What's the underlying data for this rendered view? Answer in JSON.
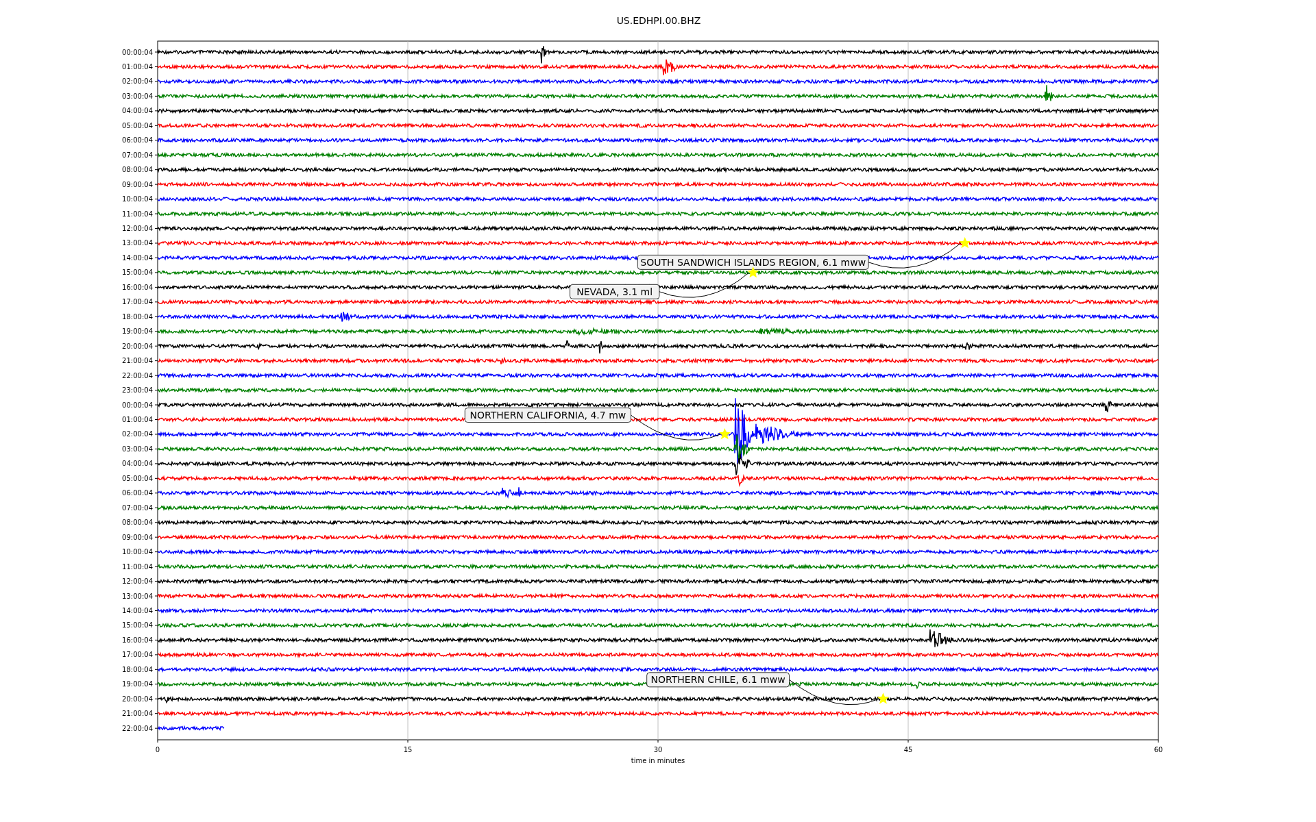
{
  "plot": {
    "title": "US.EDHPI.00.BHZ",
    "x_label": "time in minutes",
    "x_ticks": [
      "0",
      "15",
      "30",
      "45",
      "60"
    ],
    "rows": [
      {
        "label": "00:00:04",
        "color": "#000000"
      },
      {
        "label": "01:00:04",
        "color": "#ff0000"
      },
      {
        "label": "02:00:04",
        "color": "#0000ff"
      },
      {
        "label": "03:00:04",
        "color": "#008000"
      },
      {
        "label": "04:00:04",
        "color": "#000000"
      },
      {
        "label": "05:00:04",
        "color": "#ff0000"
      },
      {
        "label": "06:00:04",
        "color": "#0000ff"
      },
      {
        "label": "07:00:04",
        "color": "#008000"
      },
      {
        "label": "08:00:04",
        "color": "#000000"
      },
      {
        "label": "09:00:04",
        "color": "#ff0000"
      },
      {
        "label": "10:00:04",
        "color": "#0000ff"
      },
      {
        "label": "11:00:04",
        "color": "#008000"
      },
      {
        "label": "12:00:04",
        "color": "#000000"
      },
      {
        "label": "13:00:04",
        "color": "#ff0000"
      },
      {
        "label": "14:00:04",
        "color": "#0000ff"
      },
      {
        "label": "15:00:04",
        "color": "#008000"
      },
      {
        "label": "16:00:04",
        "color": "#000000"
      },
      {
        "label": "17:00:04",
        "color": "#ff0000"
      },
      {
        "label": "18:00:04",
        "color": "#0000ff"
      },
      {
        "label": "19:00:04",
        "color": "#008000"
      },
      {
        "label": "20:00:04",
        "color": "#000000"
      },
      {
        "label": "21:00:04",
        "color": "#ff0000"
      },
      {
        "label": "22:00:04",
        "color": "#0000ff"
      },
      {
        "label": "23:00:04",
        "color": "#008000"
      },
      {
        "label": "00:00:04",
        "color": "#000000"
      },
      {
        "label": "01:00:04",
        "color": "#ff0000"
      },
      {
        "label": "02:00:04",
        "color": "#0000ff"
      },
      {
        "label": "03:00:04",
        "color": "#008000"
      },
      {
        "label": "04:00:04",
        "color": "#000000"
      },
      {
        "label": "05:00:04",
        "color": "#ff0000"
      },
      {
        "label": "06:00:04",
        "color": "#0000ff"
      },
      {
        "label": "07:00:04",
        "color": "#008000"
      },
      {
        "label": "08:00:04",
        "color": "#000000"
      },
      {
        "label": "09:00:04",
        "color": "#ff0000"
      },
      {
        "label": "10:00:04",
        "color": "#0000ff"
      },
      {
        "label": "11:00:04",
        "color": "#008000"
      },
      {
        "label": "12:00:04",
        "color": "#000000"
      },
      {
        "label": "13:00:04",
        "color": "#ff0000"
      },
      {
        "label": "14:00:04",
        "color": "#0000ff"
      },
      {
        "label": "15:00:04",
        "color": "#008000"
      },
      {
        "label": "16:00:04",
        "color": "#000000"
      },
      {
        "label": "17:00:04",
        "color": "#ff0000"
      },
      {
        "label": "18:00:04",
        "color": "#0000ff"
      },
      {
        "label": "19:00:04",
        "color": "#008000"
      },
      {
        "label": "20:00:04",
        "color": "#000000"
      },
      {
        "label": "21:00:04",
        "color": "#ff0000"
      },
      {
        "label": "22:00:04",
        "color": "#0000ff"
      }
    ],
    "events": [
      {
        "label": "SOUTH SANDWICH ISLANDS REGION, 6.1 mww"
      },
      {
        "label": "NEVADA, 3.1 ml"
      },
      {
        "label": "NORTHERN CALIFORNIA, 4.7 mw"
      },
      {
        "label": "NORTHERN CHILE, 6.1 mww"
      }
    ]
  }
}
